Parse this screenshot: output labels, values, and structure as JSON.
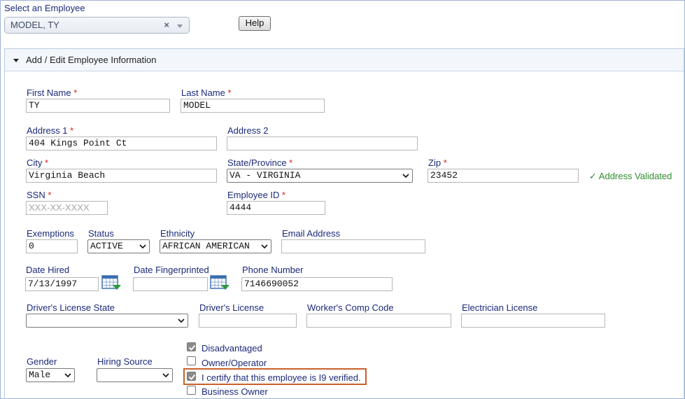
{
  "employee_select": {
    "label": "Select an Employee",
    "value": "MODEL, TY",
    "clear_icon": "×"
  },
  "help_button": "Help",
  "section": {
    "title": "Add / Edit Employee Information"
  },
  "required_mark": "*",
  "fields": {
    "first_name": {
      "label": "First Name",
      "value": "TY"
    },
    "last_name": {
      "label": "Last Name",
      "value": "MODEL"
    },
    "address1": {
      "label": "Address 1",
      "value": "404 Kings Point Ct"
    },
    "address2": {
      "label": "Address 2",
      "value": ""
    },
    "city": {
      "label": "City",
      "value": "Virginia Beach"
    },
    "state": {
      "label": "State/Province",
      "value": "VA - VIRGINIA"
    },
    "zip": {
      "label": "Zip",
      "value": "23452"
    },
    "address_status": "✓ Address Validated",
    "ssn": {
      "label": "SSN",
      "value": "",
      "placeholder": "XXX-XX-XXXX"
    },
    "employee_id": {
      "label": "Employee ID",
      "value": "4444"
    },
    "exemptions": {
      "label": "Exemptions",
      "value": "0"
    },
    "status": {
      "label": "Status",
      "value": "ACTIVE"
    },
    "ethnicity": {
      "label": "Ethnicity",
      "value": "AFRICAN AMERICAN"
    },
    "email": {
      "label": "Email Address",
      "value": ""
    },
    "date_hired": {
      "label": "Date Hired",
      "value": "7/13/1997"
    },
    "date_fingerprinted": {
      "label": "Date Fingerprinted",
      "value": ""
    },
    "phone": {
      "label": "Phone Number",
      "value": "7146690052"
    },
    "dl_state": {
      "label": "Driver's License State",
      "value": ""
    },
    "dl": {
      "label": "Driver's License",
      "value": ""
    },
    "workers_comp": {
      "label": "Worker's Comp Code",
      "value": ""
    },
    "electrician": {
      "label": "Electrician License",
      "value": ""
    },
    "gender": {
      "label": "Gender",
      "value": "Male"
    },
    "hiring_source": {
      "label": "Hiring Source",
      "value": ""
    }
  },
  "checkboxes": [
    {
      "label": "Disadvantaged",
      "checked": true
    },
    {
      "label": "Owner/Operator",
      "checked": false
    },
    {
      "label": "I certify that this employee is I9 verified.",
      "checked": true
    },
    {
      "label": "Business Owner",
      "checked": false
    }
  ],
  "colors": {
    "label": "#1b2a7a",
    "required": "#d62020",
    "validated": "#2e8b2e",
    "highlight_border": "#c8602a"
  },
  "icons": {
    "calendar": "calendar-icon",
    "collapse": "caret-down-icon",
    "clear": "close-icon",
    "dropdown": "chevron-down-icon"
  }
}
